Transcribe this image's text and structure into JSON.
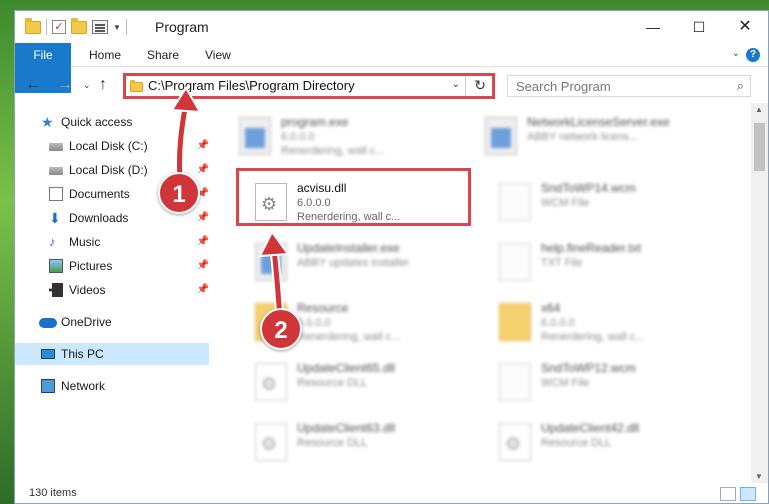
{
  "window": {
    "title": "Program",
    "min_label": "—",
    "max_label": "☐",
    "close_label": "✕"
  },
  "ribbon": {
    "tabs": [
      "File",
      "Home",
      "Share",
      "View"
    ],
    "chevron": "⌄",
    "help": "?"
  },
  "nav": {
    "back": "←",
    "forward": "→",
    "recent": "⌄",
    "up": "↑",
    "address": "C:\\Program Files\\Program Directory",
    "address_dropdown": "⌄",
    "refresh": "↻",
    "search_placeholder": "Search Program",
    "search_icon": "⌕"
  },
  "sidebar": {
    "items": [
      {
        "label": "Quick access",
        "icon": "star-icon"
      },
      {
        "label": "Local Disk (C:)",
        "icon": "disk-icon",
        "pinned": true
      },
      {
        "label": "Local Disk (D:)",
        "icon": "disk-icon",
        "pinned": true
      },
      {
        "label": "Documents",
        "icon": "documents-icon",
        "pinned": true
      },
      {
        "label": "Downloads",
        "icon": "downloads-icon",
        "pinned": true
      },
      {
        "label": "Music",
        "icon": "music-icon",
        "pinned": true
      },
      {
        "label": "Pictures",
        "icon": "pictures-icon",
        "pinned": true
      },
      {
        "label": "Videos",
        "icon": "videos-icon",
        "pinned": true
      },
      {
        "label": "OneDrive",
        "icon": "onedrive-icon"
      },
      {
        "label": "This PC",
        "icon": "pc-icon",
        "selected": true
      },
      {
        "label": "Network",
        "icon": "network-icon"
      }
    ],
    "pin_glyph": "📌"
  },
  "files": [
    {
      "name": "program.exe",
      "sub1": "6.0.0.0",
      "sub2": "Renerdering, wall c...",
      "icon": "exe-icon",
      "blurred": true
    },
    {
      "name": "NetworkLicenseServer.exe",
      "sub1": "ABBY network licens...",
      "sub2": "",
      "icon": "exe-icon",
      "blurred": true
    },
    {
      "name": "acvisu.dll",
      "sub1": "6.0.0.0",
      "sub2": "Renerdering, wall c...",
      "icon": "dll-icon",
      "blurred": false
    },
    {
      "name": "SndToWP14.wcm",
      "sub1": "WCM File",
      "sub2": "",
      "icon": "file-icon",
      "blurred": true
    },
    {
      "name": "UpdateInstaller.exe",
      "sub1": "ABBY updates installer",
      "sub2": "",
      "icon": "exe-icon",
      "blurred": true
    },
    {
      "name": "help.fineReader.txt",
      "sub1": "TXT File",
      "sub2": "",
      "icon": "file-icon",
      "blurred": true
    },
    {
      "name": "Resource",
      "sub1": "6.0.0.0",
      "sub2": "Renerdering, wall c...",
      "icon": "folder-icon",
      "blurred": true
    },
    {
      "name": "x64",
      "sub1": "6.0.0.0",
      "sub2": "Renerdering, wall c...",
      "icon": "folder-icon",
      "blurred": true
    },
    {
      "name": "UpdateClient65.dll",
      "sub1": "Resource DLL",
      "sub2": "",
      "icon": "dll-icon",
      "blurred": true
    },
    {
      "name": "SndToWP12.wcm",
      "sub1": "WCM File",
      "sub2": "",
      "icon": "file-icon",
      "blurred": true
    },
    {
      "name": "UpdateClient63.dll",
      "sub1": "Resource DLL",
      "sub2": "",
      "icon": "dll-icon",
      "blurred": true
    },
    {
      "name": "UpdateClient42.dll",
      "sub1": "Resource DLL",
      "sub2": "",
      "icon": "dll-icon",
      "blurred": true
    }
  ],
  "status": {
    "items_count": "130 items"
  },
  "callouts": [
    "1",
    "2"
  ],
  "colors": {
    "accent": "#1979ca",
    "highlight": "#d9464b",
    "selected": "#cce8ff"
  }
}
